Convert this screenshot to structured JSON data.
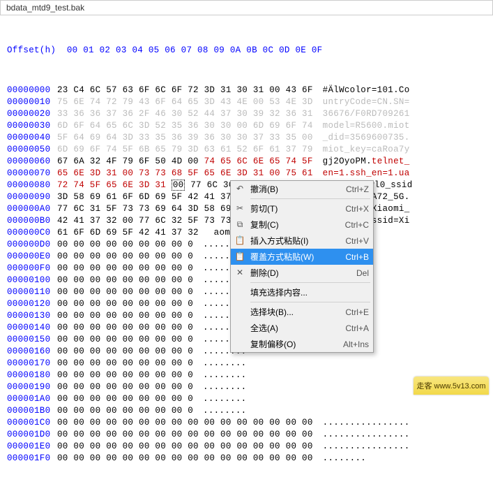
{
  "titlebar": {
    "filename": "bdata_mtd9_test.bak"
  },
  "header": {
    "label": "Offset(h)",
    "cols": "00 01 02 03 04 05 06 07 08 09 0A 0B 0C 0D 0E 0F"
  },
  "rows": [
    {
      "offset": "00000000",
      "hex": "23 C4 6C 57 63 6F 6C 6F 72 3D 31 30 31 00 43 6F",
      "ascii": "#ÄlWcolor=101.Co"
    },
    {
      "offset": "00000010",
      "hex_gray": "75 6E 74 72 79 43 6F 64 65 3D 43 4E 00 53 4E 3D",
      "ascii_gray": "untryCode=CN.SN="
    },
    {
      "offset": "00000020",
      "hex_gray": "33 36 36 37 36 2F 46 30 52 44 37 30 39 32 36 31",
      "ascii_gray": "36676/F0RD709261"
    },
    {
      "offset": "00000030",
      "hex_gray": "6D 6F 64 65 6C 3D 52 35 36 30 30 00 6D 69 6F 74",
      "ascii_gray": "model=R5600.miot"
    },
    {
      "offset": "00000040",
      "hex_gray": "5F 64 69 64 3D 33 35 36 39 36 30 30 37 33 35 00",
      "ascii_gray": "_did=3569600735."
    },
    {
      "offset": "00000050",
      "hex_gray": "6D 69 6F 74 5F 6B 65 79 3D 63 61 52 6F 61 37 79",
      "ascii_gray": "miot_key=caRoa7y"
    },
    {
      "offset": "00000060",
      "hex_n": "67 6A 32 4F 79 6F 50 4D 00 ",
      "hex_r": "74 65 6C 6E 65 74 5F",
      "ascii_n": "gj2OyoPM.",
      "ascii_r": "telnet_"
    },
    {
      "offset": "00000070",
      "hex_r": "65 6E 3D 31 00 73 73 68 5F 65 6E 3D 31 00 75 61",
      "ascii_r": "en=1.ssh_en=1.ua"
    },
    {
      "offset": "00000080",
      "hex_r": "72 74 5F 65 6E 3D 31 ",
      "hex_cur": "00",
      "hex_n": " 77 6C 30 5F 73 73 69 64",
      "ascii_r": "rt_en=1.",
      "ascii_n": "wl0_ssid"
    },
    {
      "offset": "00000090",
      "hex": "3D 58 69 61 6F 6D 69 5F 42 41 37 32 5F 35 47 00",
      "ascii": "=Xiaomi_BA72_5G."
    },
    {
      "offset": "000000A0",
      "hex": "77 6C 31 5F 73 73 69 64 3D 58 69 61 6F 6D 69 5F",
      "ascii": "wl1_ssid=Xiaomi_"
    },
    {
      "offset": "000000B0",
      "hex": "42 41 37 32 00 77 6C 32 5F 73 73 69 64 3D 58 69",
      "ascii": "BA72.wl2_ssid=Xi"
    },
    {
      "offset": "000000C0",
      "hex": "61 6F 6D 69 5F 42 41 37 32 ",
      "ascii": "aomi_BA72.",
      "ascii_cur": "."
    },
    {
      "offset": "000000D0",
      "hex": "00 00 00 00 00 00 00 00 0",
      "ascii": "........"
    },
    {
      "offset": "000000E0",
      "hex": "00 00 00 00 00 00 00 00 0",
      "ascii": "........"
    },
    {
      "offset": "000000F0",
      "hex": "00 00 00 00 00 00 00 00 0",
      "ascii": "........"
    },
    {
      "offset": "00000100",
      "hex": "00 00 00 00 00 00 00 00 0",
      "ascii": "........"
    },
    {
      "offset": "00000110",
      "hex": "00 00 00 00 00 00 00 00 0",
      "ascii": "........"
    },
    {
      "offset": "00000120",
      "hex": "00 00 00 00 00 00 00 00 0",
      "ascii": "........"
    },
    {
      "offset": "00000130",
      "hex": "00 00 00 00 00 00 00 00 0",
      "ascii": "........"
    },
    {
      "offset": "00000140",
      "hex": "00 00 00 00 00 00 00 00 0",
      "ascii": "........"
    },
    {
      "offset": "00000150",
      "hex": "00 00 00 00 00 00 00 00 0",
      "ascii": "........"
    },
    {
      "offset": "00000160",
      "hex": "00 00 00 00 00 00 00 00 0",
      "ascii": "........"
    },
    {
      "offset": "00000170",
      "hex": "00 00 00 00 00 00 00 00 0",
      "ascii": "........"
    },
    {
      "offset": "00000180",
      "hex": "00 00 00 00 00 00 00 00 0",
      "ascii": "........"
    },
    {
      "offset": "00000190",
      "hex": "00 00 00 00 00 00 00 00 0",
      "ascii": "........"
    },
    {
      "offset": "000001A0",
      "hex": "00 00 00 00 00 00 00 00 0",
      "ascii": "........"
    },
    {
      "offset": "000001B0",
      "hex": "00 00 00 00 00 00 00 00 0",
      "ascii": "........"
    },
    {
      "offset": "000001C0",
      "hex": "00 00 00 00 00 00 00 00 00 00 00 00 00 00 00 00",
      "ascii": "................"
    },
    {
      "offset": "000001D0",
      "hex": "00 00 00 00 00 00 00 00 00 00 00 00 00 00 00 00",
      "ascii": "................"
    },
    {
      "offset": "000001E0",
      "hex": "00 00 00 00 00 00 00 00 00 00 00 00 00 00 00 00",
      "ascii": "................"
    },
    {
      "offset": "000001F0",
      "hex": "00 00 00 00 00 00 00 00 00 00 00 00 00 00 00 00",
      "ascii": "........"
    }
  ],
  "menu": {
    "items": [
      {
        "icon": "undo",
        "label": "撤消(B)",
        "shortcut": "Ctrl+Z"
      },
      {
        "sep": true
      },
      {
        "icon": "cut",
        "label": "剪切(T)",
        "shortcut": "Ctrl+X"
      },
      {
        "icon": "copy",
        "label": "复制(C)",
        "shortcut": "Ctrl+C"
      },
      {
        "icon": "paste",
        "label": "插入方式粘贴(I)",
        "shortcut": "Ctrl+V"
      },
      {
        "icon": "paste",
        "label": "覆盖方式粘贴(W)",
        "shortcut": "Ctrl+B",
        "highlighted": true
      },
      {
        "icon": "delete",
        "label": "删除(D)",
        "shortcut": "Del"
      },
      {
        "sep": true
      },
      {
        "label": "填充选择内容...",
        "shortcut": ""
      },
      {
        "sep": true
      },
      {
        "label": "选择块(B)...",
        "shortcut": "Ctrl+E"
      },
      {
        "label": "全选(A)",
        "shortcut": "Ctrl+A"
      },
      {
        "label": "复制偏移(O)",
        "shortcut": "Alt+Ins"
      }
    ]
  },
  "watermark": {
    "text": "走客 www.5v13.com"
  }
}
